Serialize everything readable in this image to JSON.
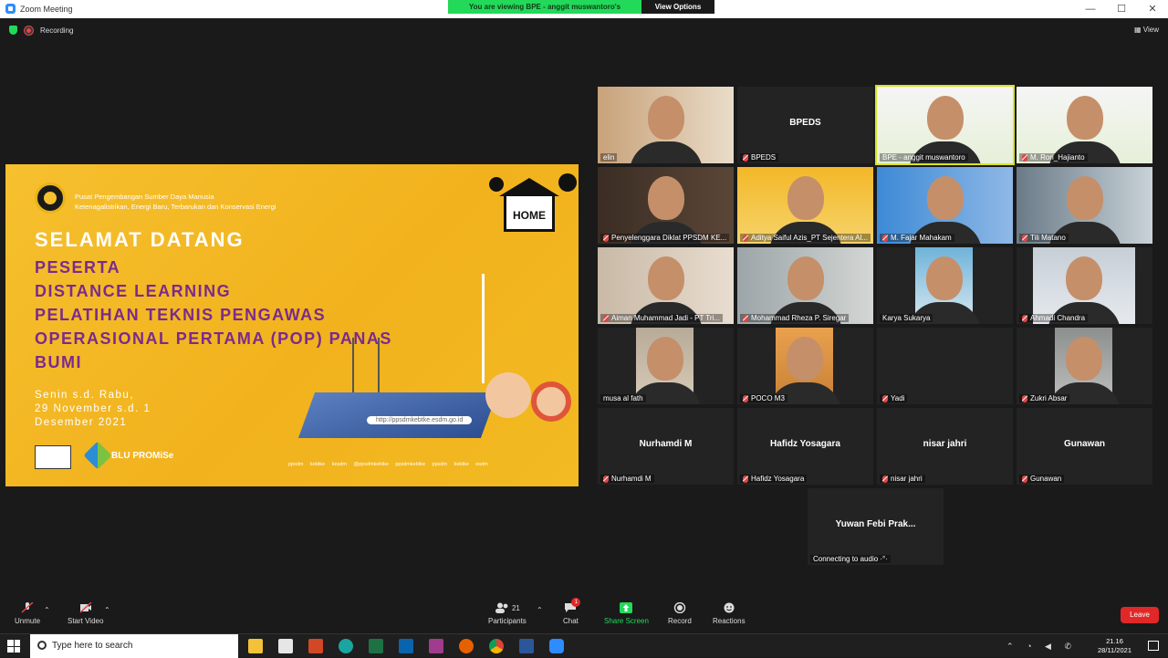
{
  "window": {
    "title": "Zoom Meeting",
    "min": "—",
    "max": "☐",
    "close": "✕"
  },
  "share_banner": {
    "message": "You are viewing BPE - anggit muswantoro's screen",
    "options": "View Options ⌄"
  },
  "status": {
    "recording": "Recording",
    "view": "View"
  },
  "slide": {
    "org_line1": "Pusat Pengembangan Sumber Daya Manusia",
    "org_line2": "Ketenagalistrikan, Energi Baru, Terbarukan dan Konservasi Energi",
    "welcome": "SELAMAT DATANG",
    "title_lines": [
      "PESERTA",
      "DISTANCE LEARNING",
      "PELATIHAN TEKNIS PENGAWAS",
      "OPERASIONAL PERTAMA (POP) PANAS",
      "BUMI"
    ],
    "date_lines": [
      "Senin s.d. Rabu,",
      "29 November s.d. 1",
      "Desember 2021"
    ],
    "url": "http://ppsdmkebtke.esdm.go.id",
    "home_label": "HOME",
    "brand": "BLU PROMiSe",
    "socials": "ppsdm kebtke kesdm   @ppsdmkebtke   ppsdmkebtke   ppsdm kebtke esdm"
  },
  "participants": [
    {
      "name": "elin",
      "big": "",
      "muted": false
    },
    {
      "name": "BPEDS",
      "big": "BPEDS",
      "muted": true
    },
    {
      "name": "BPE - anggit muswantoro",
      "big": "",
      "muted": false,
      "active": true
    },
    {
      "name": "M. Rori_Hajianto",
      "big": "",
      "muted": true
    },
    {
      "name": "Penyelenggara Diklat PPSDM KE...",
      "big": "",
      "muted": true
    },
    {
      "name": "Aditya Saiful Azis_PT Sejentera Al...",
      "big": "",
      "muted": true
    },
    {
      "name": "M. Fajar Mahakam",
      "big": "",
      "muted": true
    },
    {
      "name": "Tili Matano",
      "big": "",
      "muted": true
    },
    {
      "name": "Aiman Muhammad Jadi - PT Tri...",
      "big": "",
      "muted": true
    },
    {
      "name": "Mohammad Rheza P. Siregar",
      "big": "",
      "muted": true
    },
    {
      "name": "Karya Sukarya",
      "big": "",
      "muted": false
    },
    {
      "name": "Ahmadi Chandra",
      "big": "",
      "muted": true
    },
    {
      "name": "musa al fath",
      "big": "",
      "muted": false
    },
    {
      "name": "POCO M3",
      "big": "",
      "muted": true
    },
    {
      "name": "Yadi",
      "big": "",
      "muted": true
    },
    {
      "name": "Zukri Absar",
      "big": "",
      "muted": true
    },
    {
      "name": "Nurhamdi M",
      "big": "Nurhamdi M",
      "muted": true
    },
    {
      "name": "Hafidz Yosagara",
      "big": "Hafidz Yosagara",
      "muted": true
    },
    {
      "name": "nisar jahri",
      "big": "nisar jahri",
      "muted": true
    },
    {
      "name": "Gunawan",
      "big": "Gunawan",
      "muted": true
    },
    {
      "name": "Connecting to audio ·°·",
      "big": "Yuwan Febi Prak...",
      "muted": false
    }
  ],
  "toolbar": {
    "unmute": "Unmute",
    "video": "Start Video",
    "participants": "Participants",
    "participants_count": "21",
    "chat": "Chat",
    "chat_badge": "1",
    "share": "Share Screen",
    "record": "Record",
    "reactions": "Reactions",
    "leave": "Leave"
  },
  "taskbar": {
    "search": "Type here to search",
    "time": "21.16",
    "date": "28/11/2021"
  },
  "colors": {
    "accent_green": "#23d959",
    "leave_red": "#e02828",
    "active_border": "#d8e228",
    "slide_yellow": "#f6c02e",
    "slide_purple": "#7b2a8e"
  }
}
